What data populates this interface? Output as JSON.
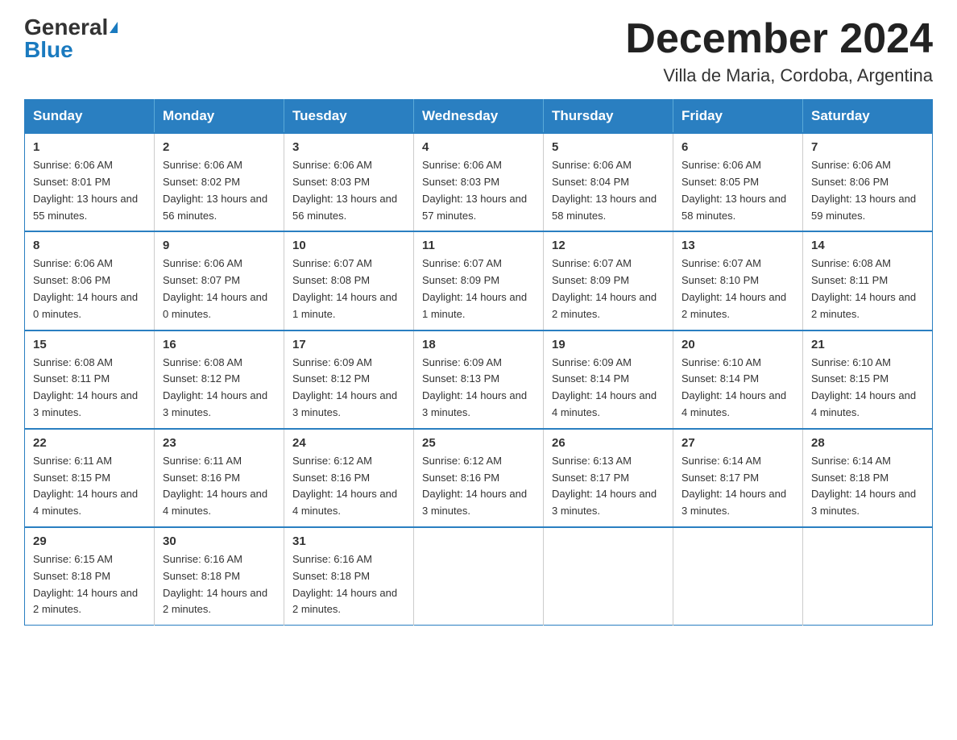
{
  "header": {
    "logo_general": "General",
    "logo_blue": "Blue",
    "month_title": "December 2024",
    "location": "Villa de Maria, Cordoba, Argentina"
  },
  "weekdays": [
    "Sunday",
    "Monday",
    "Tuesday",
    "Wednesday",
    "Thursday",
    "Friday",
    "Saturday"
  ],
  "weeks": [
    [
      {
        "day": "1",
        "sunrise": "6:06 AM",
        "sunset": "8:01 PM",
        "daylight": "13 hours and 55 minutes."
      },
      {
        "day": "2",
        "sunrise": "6:06 AM",
        "sunset": "8:02 PM",
        "daylight": "13 hours and 56 minutes."
      },
      {
        "day": "3",
        "sunrise": "6:06 AM",
        "sunset": "8:03 PM",
        "daylight": "13 hours and 56 minutes."
      },
      {
        "day": "4",
        "sunrise": "6:06 AM",
        "sunset": "8:03 PM",
        "daylight": "13 hours and 57 minutes."
      },
      {
        "day": "5",
        "sunrise": "6:06 AM",
        "sunset": "8:04 PM",
        "daylight": "13 hours and 58 minutes."
      },
      {
        "day": "6",
        "sunrise": "6:06 AM",
        "sunset": "8:05 PM",
        "daylight": "13 hours and 58 minutes."
      },
      {
        "day": "7",
        "sunrise": "6:06 AM",
        "sunset": "8:06 PM",
        "daylight": "13 hours and 59 minutes."
      }
    ],
    [
      {
        "day": "8",
        "sunrise": "6:06 AM",
        "sunset": "8:06 PM",
        "daylight": "14 hours and 0 minutes."
      },
      {
        "day": "9",
        "sunrise": "6:06 AM",
        "sunset": "8:07 PM",
        "daylight": "14 hours and 0 minutes."
      },
      {
        "day": "10",
        "sunrise": "6:07 AM",
        "sunset": "8:08 PM",
        "daylight": "14 hours and 1 minute."
      },
      {
        "day": "11",
        "sunrise": "6:07 AM",
        "sunset": "8:09 PM",
        "daylight": "14 hours and 1 minute."
      },
      {
        "day": "12",
        "sunrise": "6:07 AM",
        "sunset": "8:09 PM",
        "daylight": "14 hours and 2 minutes."
      },
      {
        "day": "13",
        "sunrise": "6:07 AM",
        "sunset": "8:10 PM",
        "daylight": "14 hours and 2 minutes."
      },
      {
        "day": "14",
        "sunrise": "6:08 AM",
        "sunset": "8:11 PM",
        "daylight": "14 hours and 2 minutes."
      }
    ],
    [
      {
        "day": "15",
        "sunrise": "6:08 AM",
        "sunset": "8:11 PM",
        "daylight": "14 hours and 3 minutes."
      },
      {
        "day": "16",
        "sunrise": "6:08 AM",
        "sunset": "8:12 PM",
        "daylight": "14 hours and 3 minutes."
      },
      {
        "day": "17",
        "sunrise": "6:09 AM",
        "sunset": "8:12 PM",
        "daylight": "14 hours and 3 minutes."
      },
      {
        "day": "18",
        "sunrise": "6:09 AM",
        "sunset": "8:13 PM",
        "daylight": "14 hours and 3 minutes."
      },
      {
        "day": "19",
        "sunrise": "6:09 AM",
        "sunset": "8:14 PM",
        "daylight": "14 hours and 4 minutes."
      },
      {
        "day": "20",
        "sunrise": "6:10 AM",
        "sunset": "8:14 PM",
        "daylight": "14 hours and 4 minutes."
      },
      {
        "day": "21",
        "sunrise": "6:10 AM",
        "sunset": "8:15 PM",
        "daylight": "14 hours and 4 minutes."
      }
    ],
    [
      {
        "day": "22",
        "sunrise": "6:11 AM",
        "sunset": "8:15 PM",
        "daylight": "14 hours and 4 minutes."
      },
      {
        "day": "23",
        "sunrise": "6:11 AM",
        "sunset": "8:16 PM",
        "daylight": "14 hours and 4 minutes."
      },
      {
        "day": "24",
        "sunrise": "6:12 AM",
        "sunset": "8:16 PM",
        "daylight": "14 hours and 4 minutes."
      },
      {
        "day": "25",
        "sunrise": "6:12 AM",
        "sunset": "8:16 PM",
        "daylight": "14 hours and 3 minutes."
      },
      {
        "day": "26",
        "sunrise": "6:13 AM",
        "sunset": "8:17 PM",
        "daylight": "14 hours and 3 minutes."
      },
      {
        "day": "27",
        "sunrise": "6:14 AM",
        "sunset": "8:17 PM",
        "daylight": "14 hours and 3 minutes."
      },
      {
        "day": "28",
        "sunrise": "6:14 AM",
        "sunset": "8:18 PM",
        "daylight": "14 hours and 3 minutes."
      }
    ],
    [
      {
        "day": "29",
        "sunrise": "6:15 AM",
        "sunset": "8:18 PM",
        "daylight": "14 hours and 2 minutes."
      },
      {
        "day": "30",
        "sunrise": "6:16 AM",
        "sunset": "8:18 PM",
        "daylight": "14 hours and 2 minutes."
      },
      {
        "day": "31",
        "sunrise": "6:16 AM",
        "sunset": "8:18 PM",
        "daylight": "14 hours and 2 minutes."
      },
      null,
      null,
      null,
      null
    ]
  ]
}
